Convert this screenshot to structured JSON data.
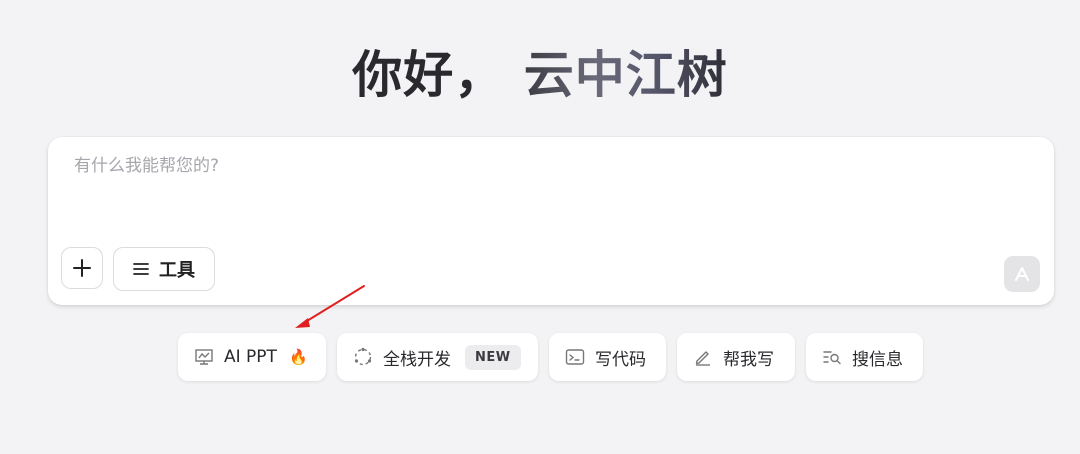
{
  "greeting": {
    "hello": "你好，",
    "name": "云中江树"
  },
  "composer": {
    "placeholder": "有什么我能帮您的?",
    "add_label": "+",
    "tools_label": "工具"
  },
  "chips": [
    {
      "label": "AI PPT",
      "icon": "presentation-chart-icon",
      "extra": "🔥"
    },
    {
      "label": "全栈开发",
      "icon": "dotted-circle-icon",
      "badge": "NEW"
    },
    {
      "label": "写代码",
      "icon": "terminal-icon"
    },
    {
      "label": "帮我写",
      "icon": "pen-icon"
    },
    {
      "label": "搜信息",
      "icon": "search-list-icon"
    }
  ],
  "colors": {
    "background": "#f3f3f5",
    "card": "#ffffff",
    "annotation_arrow": "#e02020"
  }
}
